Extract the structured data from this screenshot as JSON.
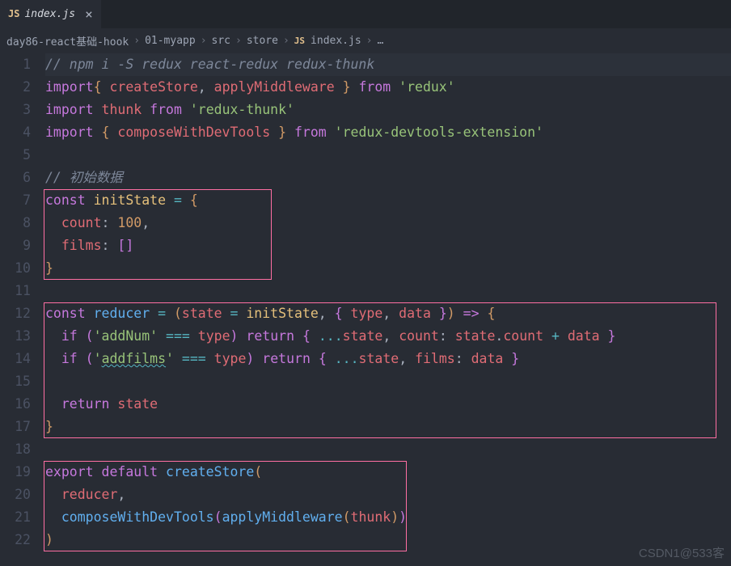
{
  "tab": {
    "icon": "JS",
    "name": "index.js",
    "close": "×"
  },
  "breadcrumbs": {
    "items": [
      {
        "label": "day86-react基础-hook"
      },
      {
        "label": "01-myapp"
      },
      {
        "label": "src"
      },
      {
        "label": "store"
      },
      {
        "label": "index.js",
        "icon": "JS"
      }
    ],
    "sep": "›",
    "more": "…"
  },
  "line_numbers": [
    "1",
    "2",
    "3",
    "4",
    "5",
    "6",
    "7",
    "8",
    "9",
    "10",
    "11",
    "12",
    "13",
    "14",
    "15",
    "16",
    "17",
    "18",
    "19",
    "20",
    "21",
    "22"
  ],
  "code": {
    "l1_comment": "// npm i -S redux react-redux redux-thunk",
    "l2": {
      "import": "import",
      "brace_l": "{ ",
      "s1": "createStore",
      "comma": ", ",
      "s2": "applyMiddleware",
      "brace_r": " }",
      "from": " from ",
      "pkg": "'redux'"
    },
    "l3": {
      "import": "import",
      "s1": " thunk ",
      "from": "from ",
      "pkg": "'redux-thunk'"
    },
    "l4": {
      "import": "import",
      "brace_l": " { ",
      "s1": "composeWithDevTools",
      "brace_r": " } ",
      "from": "from ",
      "pkg": "'redux-devtools-extension'"
    },
    "l6_comment": "// 初始数据",
    "l7": {
      "const": "const",
      "name": " initState ",
      "eq": "= ",
      "brace": "{"
    },
    "l8": {
      "prop": "count",
      "colon": ": ",
      "val": "100",
      "comma": ","
    },
    "l9": {
      "prop": "films",
      "colon": ": ",
      "arr": "[]"
    },
    "l10": {
      "brace": "}"
    },
    "l12": {
      "const": "const",
      "name": " reducer ",
      "eq": "= ",
      "p1": "(",
      "arg1": "state ",
      "def": "= ",
      "init": "initState",
      "comma": ", ",
      "brace_l": "{ ",
      "a2": "type",
      "c2": ", ",
      "a3": "data",
      "brace_r": " }",
      "p2": ")",
      "arrow": " => ",
      "b2": "{"
    },
    "l13": {
      "if": "if",
      "p1": " (",
      "str": "'addNum'",
      "eq": " === ",
      "t": "type",
      "p2": ") ",
      "ret": "return",
      "b1": " { ",
      "spread": "...",
      "s": "state",
      "c": ", ",
      "prop": "count",
      "col": ": ",
      "s2": "state",
      "dot": ".",
      "prop2": "count",
      "plus": " + ",
      "d": "data",
      "b2": " }"
    },
    "l14": {
      "if": "if",
      "p1": " (",
      "str": "'addfilms'",
      "eq": " === ",
      "t": "type",
      "p2": ") ",
      "ret": "return",
      "b1": " { ",
      "spread": "...",
      "s": "state",
      "c": ", ",
      "prop": "films",
      "col": ": ",
      "d": "data",
      "b2": " }"
    },
    "l16": {
      "ret": "return",
      "s": " state"
    },
    "l17": {
      "brace": "}"
    },
    "l19": {
      "export": "export",
      "default": " default ",
      "fn": "createStore",
      "p": "("
    },
    "l20": {
      "arg": "reducer",
      "c": ","
    },
    "l21": {
      "fn1": "composeWithDevTools",
      "p1": "(",
      "fn2": "applyMiddleware",
      "p2": "(",
      "arg": "thunk",
      "p3": ")",
      "p4": ")"
    },
    "l22": {
      "p": ")"
    }
  },
  "watermark": "CSDN1@533客"
}
